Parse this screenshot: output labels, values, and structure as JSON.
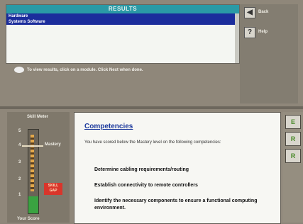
{
  "results_window": {
    "title": "RESULTS",
    "items": [
      "Hardware",
      "Systems Software"
    ]
  },
  "side": {
    "back_label": "Back",
    "help_label": "Help",
    "back_icon": "back-arrow-icon",
    "help_icon": "help-question-icon"
  },
  "instruction": "To view results, click on a module.  Click Next when done.",
  "skill_meter": {
    "title": "Skill Meter",
    "scale": [
      "5",
      "4",
      "3",
      "2",
      "1"
    ],
    "mastery_label": "Mastery",
    "gap_label_line1": "SKILL",
    "gap_label_line2": "GAP",
    "level_fraction": 0.2,
    "bottom_label": "Your Score"
  },
  "competencies": {
    "title": "Competencies",
    "description": "You have scored below the Mastery level on the following competencies:",
    "items": [
      "Determine cabling requirements/routing",
      "Establish connectivity to remote controllers",
      "Identify the necessary components to ensure a functional computing environment."
    ]
  },
  "tools": [
    "E",
    "R",
    "R"
  ],
  "colors": {
    "title_bar": "#2a9aa6",
    "selection": "#1b2d9c",
    "meter_fill": "#3aa341",
    "gap": "#d9352b",
    "comp_title": "#1d3a9d"
  }
}
